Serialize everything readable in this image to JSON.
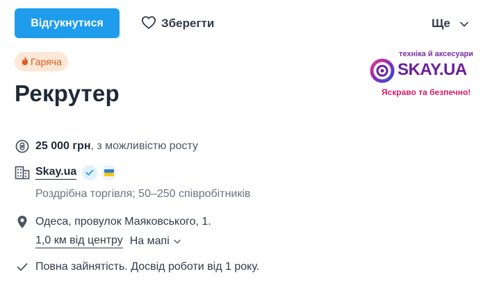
{
  "actions": {
    "respond_label": "Відгукнутися",
    "save_label": "Зберегти",
    "more_label": "Ще"
  },
  "badge": {
    "hot_label": "Гаряча"
  },
  "vacancy": {
    "title": "Рекрутер"
  },
  "logo": {
    "top_text": "техніка й аксесуари",
    "brand_text": "SKAY.UA",
    "slogan": "Яскраво та безпечно!"
  },
  "salary": {
    "amount": "25 000 грн",
    "note": ", з можливістю росту"
  },
  "company": {
    "name": "Skay.ua",
    "info": "Роздрібна торгівля; 50–250 співробітників"
  },
  "location": {
    "address": "Одеса, провулок Маяковського, 1.",
    "distance": "1,0 км від центру",
    "map_label": "На мапі"
  },
  "conditions": {
    "text": "Повна зайнятість. Досвід роботи від 1 року."
  },
  "colors": {
    "primary": "#1f9cec",
    "hot_bg": "#fde7d6",
    "hot_text": "#e05a1b",
    "brand_purple": "#6a1e9a",
    "brand_pink": "#d81b6a"
  }
}
